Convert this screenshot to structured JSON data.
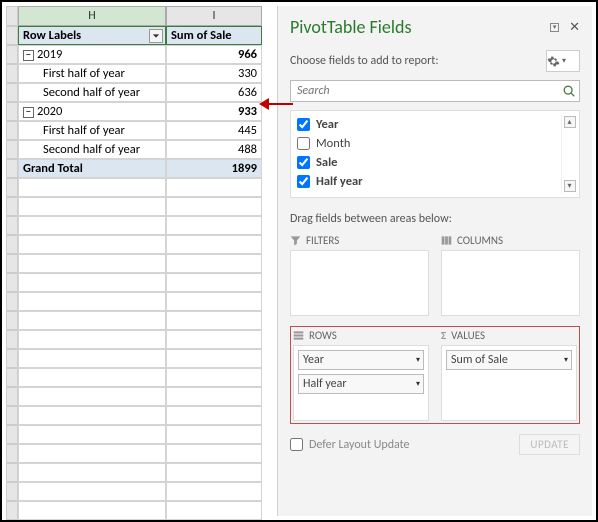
{
  "columns": {
    "H": "H",
    "I": "I"
  },
  "headers": {
    "row_labels": "Row Labels",
    "sum_of_sale": "Sum of Sale"
  },
  "rows": [
    {
      "label": "2019",
      "value": "966",
      "kind": "group"
    },
    {
      "label": "First half of year",
      "value": "330",
      "kind": "item"
    },
    {
      "label": "Second half of year",
      "value": "636",
      "kind": "item"
    },
    {
      "label": "2020",
      "value": "933",
      "kind": "group"
    },
    {
      "label": "First half of year",
      "value": "445",
      "kind": "item"
    },
    {
      "label": "Second half of year",
      "value": "488",
      "kind": "item"
    }
  ],
  "grand_total": {
    "label": "Grand Total",
    "value": "1899"
  },
  "pane": {
    "title": "PivotTable Fields",
    "choose": "Choose fields to add to report:",
    "search_placeholder": "Search",
    "fields": [
      {
        "name": "Year",
        "checked": true,
        "bold": true
      },
      {
        "name": "Month",
        "checked": false,
        "bold": false
      },
      {
        "name": "Sale",
        "checked": true,
        "bold": true
      },
      {
        "name": "Half year",
        "checked": true,
        "bold": true
      }
    ],
    "drag_label": "Drag fields between areas below:",
    "area_labels": {
      "filters": "FILTERS",
      "columns": "COLUMNS",
      "rows": "ROWS",
      "values": "VALUES"
    },
    "rows_chips": [
      "Year",
      "Half year"
    ],
    "values_chips": [
      "Sum of Sale"
    ],
    "defer": "Defer Layout Update",
    "update": "UPDATE"
  }
}
